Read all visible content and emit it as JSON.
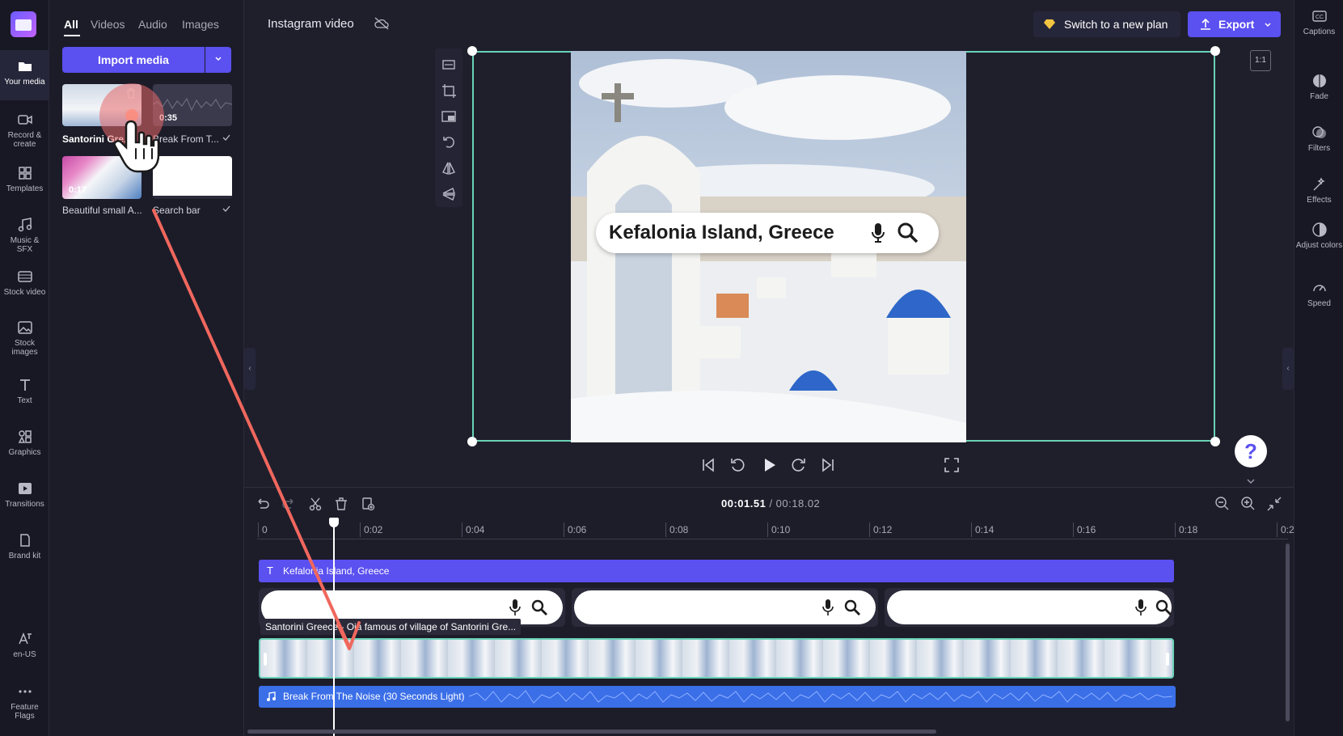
{
  "app": {
    "project_title": "Instagram video"
  },
  "leftnav": {
    "items": [
      {
        "label": "Your media",
        "icon": "folder-icon"
      },
      {
        "label": "Record & create",
        "icon": "camera-icon"
      },
      {
        "label": "Templates",
        "icon": "templates-icon"
      },
      {
        "label": "Music & SFX",
        "icon": "music-icon"
      },
      {
        "label": "Stock video",
        "icon": "film-icon"
      },
      {
        "label": "Stock images",
        "icon": "image-icon"
      },
      {
        "label": "Text",
        "icon": "text-icon"
      },
      {
        "label": "Graphics",
        "icon": "shapes-icon"
      },
      {
        "label": "Transitions",
        "icon": "transitions-icon"
      },
      {
        "label": "Brand kit",
        "icon": "brand-kit-icon"
      }
    ],
    "bottom": [
      {
        "label": "en-US",
        "icon": "language-icon"
      },
      {
        "label": "Feature Flags",
        "icon": "more-icon"
      }
    ]
  },
  "media": {
    "tabs": [
      "All",
      "Videos",
      "Audio",
      "Images"
    ],
    "import_label": "Import media",
    "items": [
      {
        "label": "Santorini Gre...",
        "duration": ""
      },
      {
        "label": "Break From T...",
        "duration": "0:35"
      },
      {
        "label": "Beautiful small A...",
        "duration": "0:17"
      },
      {
        "label": "Search bar",
        "duration": ""
      }
    ]
  },
  "header": {
    "plan_label": "Switch to a new plan",
    "export_label": "Export",
    "aspect_ratio": "1:1"
  },
  "preview": {
    "search_text": "Kefalonia Island, Greece"
  },
  "timeline": {
    "current_time": "00:01.51",
    "total_time": "/ 00:18.02",
    "ticks": [
      "0",
      "0:02",
      "0:04",
      "0:06",
      "0:08",
      "0:10",
      "0:12",
      "0:14",
      "0:16",
      "0:18",
      "0:2"
    ],
    "text_track": "Kefalonia Island, Greece",
    "video_clip_label": "Santorini Greece - Oia famous of village of Santorini Gre...",
    "audio_track": "Break From The Noise (30 Seconds Light)"
  },
  "rightrail": {
    "items": [
      {
        "label": "Captions",
        "icon": "captions-icon"
      },
      {
        "label": "Fade",
        "icon": "fade-icon"
      },
      {
        "label": "Filters",
        "icon": "filters-icon"
      },
      {
        "label": "Effects",
        "icon": "effects-icon"
      },
      {
        "label": "Adjust colors",
        "icon": "adjust-colors-icon"
      },
      {
        "label": "Speed",
        "icon": "speed-icon"
      }
    ]
  },
  "help_label": "?"
}
